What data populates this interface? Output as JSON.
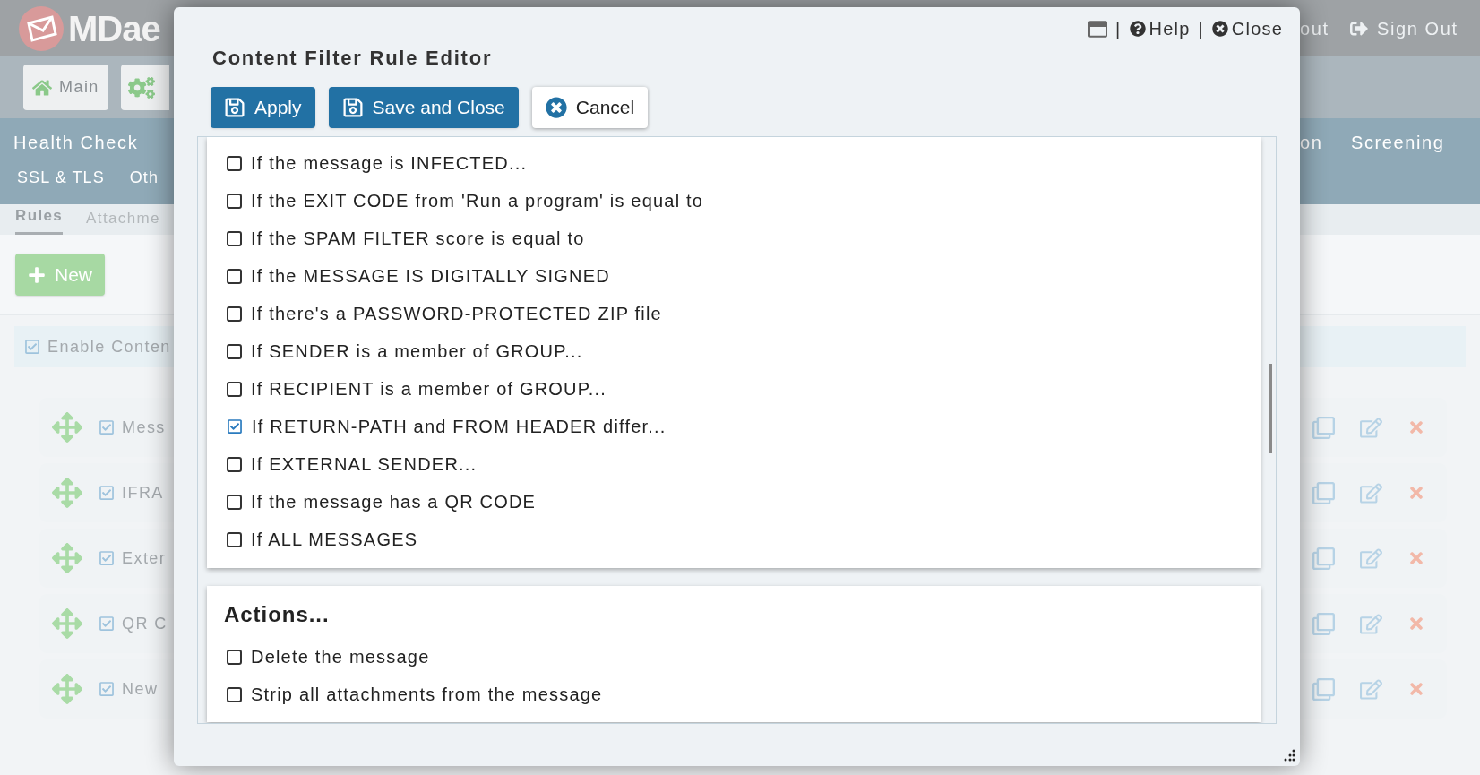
{
  "background": {
    "logo_text": "MDae",
    "header_right": [
      "out",
      "Sign Out"
    ],
    "toolbar": [
      {
        "label": "Main"
      }
    ],
    "nav_left": [
      "Health Check"
    ],
    "nav_right": [
      "on",
      "Screening"
    ],
    "nav2_left": [
      "SSL & TLS",
      "Oth"
    ],
    "subtabs": [
      {
        "label": "Rules",
        "selected": true
      },
      {
        "label": "Attachme",
        "selected": false
      }
    ],
    "new_button": "New",
    "enable": {
      "label": "Enable Conten",
      "checked": true
    },
    "rules": [
      {
        "name": "Mess",
        "enabled": true
      },
      {
        "name": "IFRA",
        "enabled": true
      },
      {
        "name": "Exter",
        "enabled": true
      },
      {
        "name": "QR C",
        "enabled": true
      },
      {
        "name": "New",
        "enabled": true
      }
    ]
  },
  "dialog": {
    "title": "Content Filter Rule Editor",
    "links": [
      "Help",
      "Close"
    ],
    "separators": [
      "|",
      "|"
    ],
    "buttons": [
      {
        "label": "Apply",
        "kind": "save"
      },
      {
        "label": "Save and Close",
        "kind": "save"
      },
      {
        "label": "Cancel",
        "kind": "cancel"
      }
    ],
    "conditions": [
      {
        "label": "If the message is INFECTED...",
        "checked": false
      },
      {
        "label": "If the EXIT CODE from 'Run a program' is equal to",
        "checked": false
      },
      {
        "label": "If the SPAM FILTER score is equal to",
        "checked": false
      },
      {
        "label": "If the MESSAGE IS DIGITALLY SIGNED",
        "checked": false
      },
      {
        "label": "If there's a PASSWORD-PROTECTED ZIP file",
        "checked": false
      },
      {
        "label": "If SENDER is a member of GROUP...",
        "checked": false
      },
      {
        "label": "If RECIPIENT is a member of GROUP...",
        "checked": false
      },
      {
        "label": "If RETURN-PATH and FROM HEADER differ...",
        "checked": true
      },
      {
        "label": "If EXTERNAL SENDER...",
        "checked": false
      },
      {
        "label": "If the message has a QR CODE",
        "checked": false
      },
      {
        "label": "If ALL MESSAGES",
        "checked": false
      }
    ],
    "actions": {
      "title": "Actions...",
      "items": [
        {
          "label": "Delete the message",
          "checked": false
        },
        {
          "label": "Strip all attachments from the message",
          "checked": false
        }
      ]
    }
  }
}
